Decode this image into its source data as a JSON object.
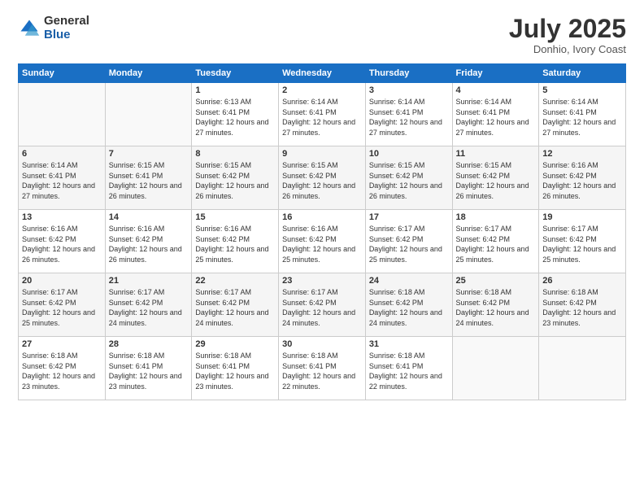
{
  "logo": {
    "general": "General",
    "blue": "Blue"
  },
  "title": "July 2025",
  "location": "Donhio, Ivory Coast",
  "days_header": [
    "Sunday",
    "Monday",
    "Tuesday",
    "Wednesday",
    "Thursday",
    "Friday",
    "Saturday"
  ],
  "weeks": [
    [
      {
        "day": "",
        "info": ""
      },
      {
        "day": "",
        "info": ""
      },
      {
        "day": "1",
        "info": "Sunrise: 6:13 AM\nSunset: 6:41 PM\nDaylight: 12 hours and 27 minutes."
      },
      {
        "day": "2",
        "info": "Sunrise: 6:14 AM\nSunset: 6:41 PM\nDaylight: 12 hours and 27 minutes."
      },
      {
        "day": "3",
        "info": "Sunrise: 6:14 AM\nSunset: 6:41 PM\nDaylight: 12 hours and 27 minutes."
      },
      {
        "day": "4",
        "info": "Sunrise: 6:14 AM\nSunset: 6:41 PM\nDaylight: 12 hours and 27 minutes."
      },
      {
        "day": "5",
        "info": "Sunrise: 6:14 AM\nSunset: 6:41 PM\nDaylight: 12 hours and 27 minutes."
      }
    ],
    [
      {
        "day": "6",
        "info": "Sunrise: 6:14 AM\nSunset: 6:41 PM\nDaylight: 12 hours and 27 minutes."
      },
      {
        "day": "7",
        "info": "Sunrise: 6:15 AM\nSunset: 6:41 PM\nDaylight: 12 hours and 26 minutes."
      },
      {
        "day": "8",
        "info": "Sunrise: 6:15 AM\nSunset: 6:42 PM\nDaylight: 12 hours and 26 minutes."
      },
      {
        "day": "9",
        "info": "Sunrise: 6:15 AM\nSunset: 6:42 PM\nDaylight: 12 hours and 26 minutes."
      },
      {
        "day": "10",
        "info": "Sunrise: 6:15 AM\nSunset: 6:42 PM\nDaylight: 12 hours and 26 minutes."
      },
      {
        "day": "11",
        "info": "Sunrise: 6:15 AM\nSunset: 6:42 PM\nDaylight: 12 hours and 26 minutes."
      },
      {
        "day": "12",
        "info": "Sunrise: 6:16 AM\nSunset: 6:42 PM\nDaylight: 12 hours and 26 minutes."
      }
    ],
    [
      {
        "day": "13",
        "info": "Sunrise: 6:16 AM\nSunset: 6:42 PM\nDaylight: 12 hours and 26 minutes."
      },
      {
        "day": "14",
        "info": "Sunrise: 6:16 AM\nSunset: 6:42 PM\nDaylight: 12 hours and 26 minutes."
      },
      {
        "day": "15",
        "info": "Sunrise: 6:16 AM\nSunset: 6:42 PM\nDaylight: 12 hours and 25 minutes."
      },
      {
        "day": "16",
        "info": "Sunrise: 6:16 AM\nSunset: 6:42 PM\nDaylight: 12 hours and 25 minutes."
      },
      {
        "day": "17",
        "info": "Sunrise: 6:17 AM\nSunset: 6:42 PM\nDaylight: 12 hours and 25 minutes."
      },
      {
        "day": "18",
        "info": "Sunrise: 6:17 AM\nSunset: 6:42 PM\nDaylight: 12 hours and 25 minutes."
      },
      {
        "day": "19",
        "info": "Sunrise: 6:17 AM\nSunset: 6:42 PM\nDaylight: 12 hours and 25 minutes."
      }
    ],
    [
      {
        "day": "20",
        "info": "Sunrise: 6:17 AM\nSunset: 6:42 PM\nDaylight: 12 hours and 25 minutes."
      },
      {
        "day": "21",
        "info": "Sunrise: 6:17 AM\nSunset: 6:42 PM\nDaylight: 12 hours and 24 minutes."
      },
      {
        "day": "22",
        "info": "Sunrise: 6:17 AM\nSunset: 6:42 PM\nDaylight: 12 hours and 24 minutes."
      },
      {
        "day": "23",
        "info": "Sunrise: 6:17 AM\nSunset: 6:42 PM\nDaylight: 12 hours and 24 minutes."
      },
      {
        "day": "24",
        "info": "Sunrise: 6:18 AM\nSunset: 6:42 PM\nDaylight: 12 hours and 24 minutes."
      },
      {
        "day": "25",
        "info": "Sunrise: 6:18 AM\nSunset: 6:42 PM\nDaylight: 12 hours and 24 minutes."
      },
      {
        "day": "26",
        "info": "Sunrise: 6:18 AM\nSunset: 6:42 PM\nDaylight: 12 hours and 23 minutes."
      }
    ],
    [
      {
        "day": "27",
        "info": "Sunrise: 6:18 AM\nSunset: 6:42 PM\nDaylight: 12 hours and 23 minutes."
      },
      {
        "day": "28",
        "info": "Sunrise: 6:18 AM\nSunset: 6:41 PM\nDaylight: 12 hours and 23 minutes."
      },
      {
        "day": "29",
        "info": "Sunrise: 6:18 AM\nSunset: 6:41 PM\nDaylight: 12 hours and 23 minutes."
      },
      {
        "day": "30",
        "info": "Sunrise: 6:18 AM\nSunset: 6:41 PM\nDaylight: 12 hours and 22 minutes."
      },
      {
        "day": "31",
        "info": "Sunrise: 6:18 AM\nSunset: 6:41 PM\nDaylight: 12 hours and 22 minutes."
      },
      {
        "day": "",
        "info": ""
      },
      {
        "day": "",
        "info": ""
      }
    ]
  ]
}
